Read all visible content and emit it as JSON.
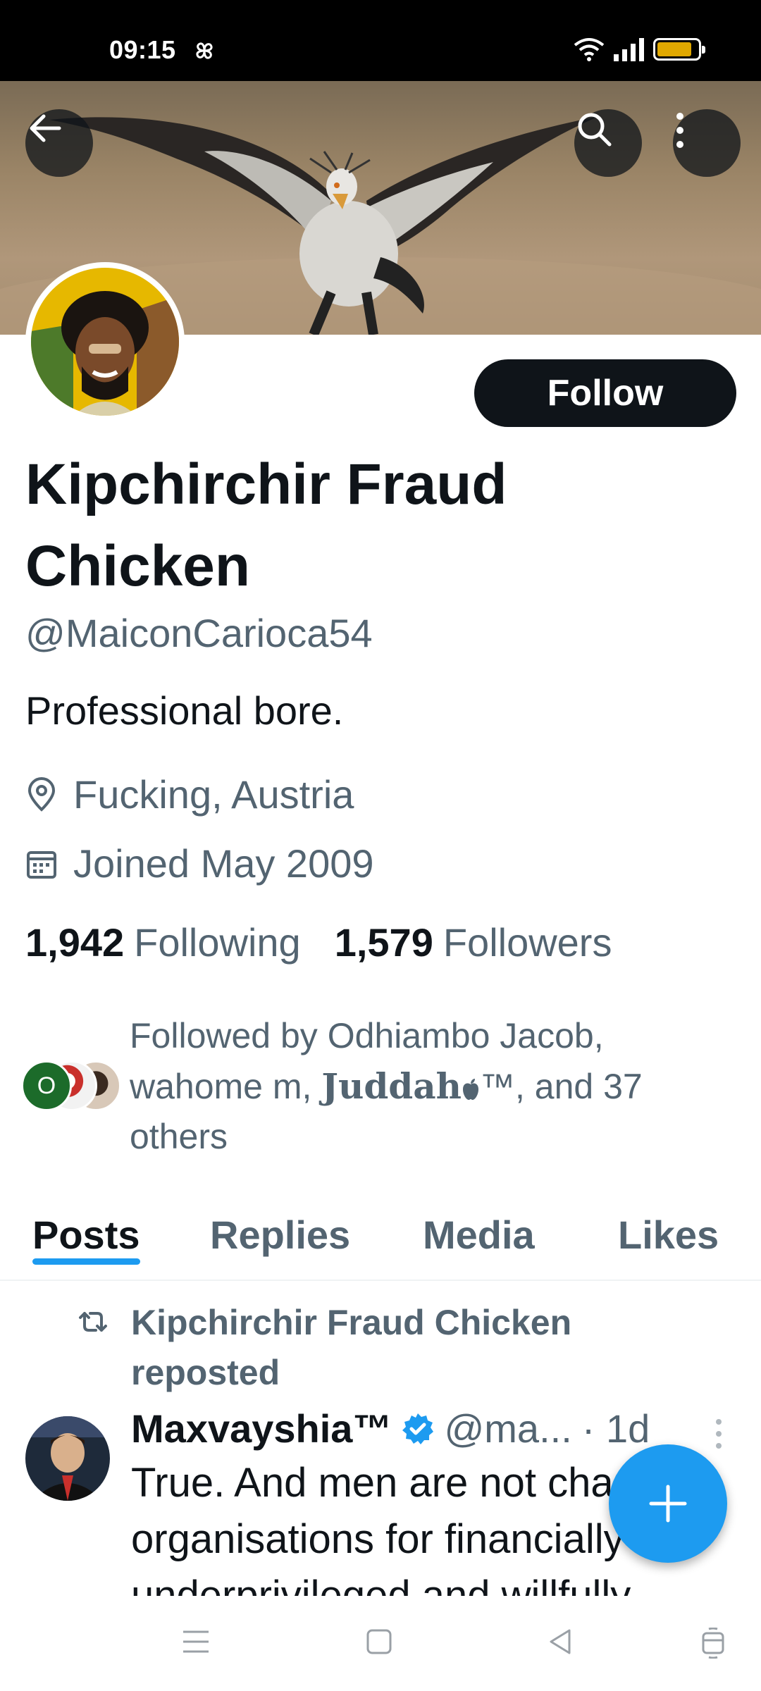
{
  "status_bar": {
    "time": "09:15",
    "battery_level": 0.85,
    "battery_color": "#e0a800"
  },
  "profile": {
    "display_name": "Kipchirchir Fraud Chicken",
    "handle": "@MaiconCarioca54",
    "bio": "Professional bore.",
    "location": "Fucking, Austria",
    "joined": "Joined May 2009",
    "following_count": "1,942",
    "following_label": "Following",
    "followers_count": "1,579",
    "followers_label": "Followers",
    "follow_button": "Follow"
  },
  "followed_by": {
    "prefix": "Followed by Odhiambo Jacob, wahome m, ",
    "fancy_name": "Juddah",
    "fancy_suffix": "™",
    "suffix": ", and 37 others",
    "avatar_initial": "O"
  },
  "tabs": [
    {
      "label": "Posts",
      "active": true
    },
    {
      "label": "Replies",
      "active": false
    },
    {
      "label": "Media",
      "active": false
    },
    {
      "label": "Likes",
      "active": false
    }
  ],
  "post": {
    "repost_label": "Kipchirchir Fraud Chicken reposted",
    "author_name": "Maxvayshia™",
    "author_handle": "@ma...",
    "time": "· 1d",
    "text": "True. And men are not charity organisations for financially underprivileged and willfully"
  },
  "icons": {
    "back": "arrow-left-icon",
    "search": "search-icon",
    "more": "more-vertical-icon",
    "location": "location-pin-icon",
    "calendar": "calendar-icon",
    "repost": "repost-icon",
    "verified": "verified-badge-icon",
    "compose": "plus-icon"
  },
  "colors": {
    "accent": "#1d9bf0",
    "text": "#0f1419",
    "secondary": "#536471"
  }
}
